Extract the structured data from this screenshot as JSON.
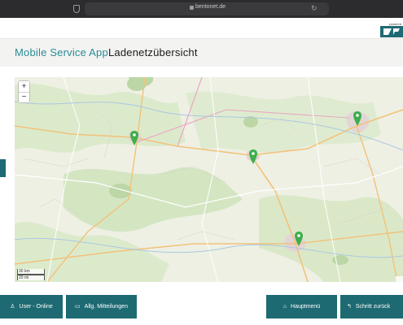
{
  "browser": {
    "url": "bentonet.de",
    "lock_icon": "lock-icon",
    "shield_icon": "shield-icon",
    "reload_icon": "reload-icon"
  },
  "brand": {
    "small_text": "powered",
    "logo_text": "B",
    "accent": "#1e6a73"
  },
  "header": {
    "app_title": "Mobile Service App",
    "page_title": "Ladenetzübersicht"
  },
  "map": {
    "zoom_in": "+",
    "zoom_out": "−",
    "scale_km": "30 km",
    "scale_mi": "20 mi",
    "marker_color": "#3eae4c",
    "markers": [
      {
        "id": "1"
      },
      {
        "id": "2"
      },
      {
        "id": "3"
      },
      {
        "id": "4"
      }
    ]
  },
  "footer": {
    "user_online": "User - Online",
    "messages": "Allg. Mitteilungen",
    "main_menu": "Hauptmenü",
    "step_back": "Schritt zurück"
  }
}
